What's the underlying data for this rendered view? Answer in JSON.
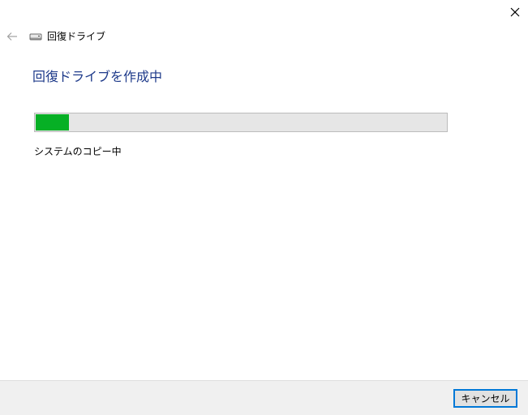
{
  "window": {
    "nav_title": "回復ドライブ"
  },
  "main": {
    "heading": "回復ドライブを作成中",
    "progress": {
      "value_percent": 8,
      "fill_color": "#06b025",
      "track_color": "#e6e6e6"
    },
    "status_text": "システムのコピー中"
  },
  "footer": {
    "cancel_label": "キャンセル"
  },
  "icons": {
    "back": "back-arrow-icon",
    "drive": "drive-icon",
    "close": "close-icon"
  },
  "colors": {
    "heading": "#1e3a8a",
    "accent": "#0078d7"
  }
}
